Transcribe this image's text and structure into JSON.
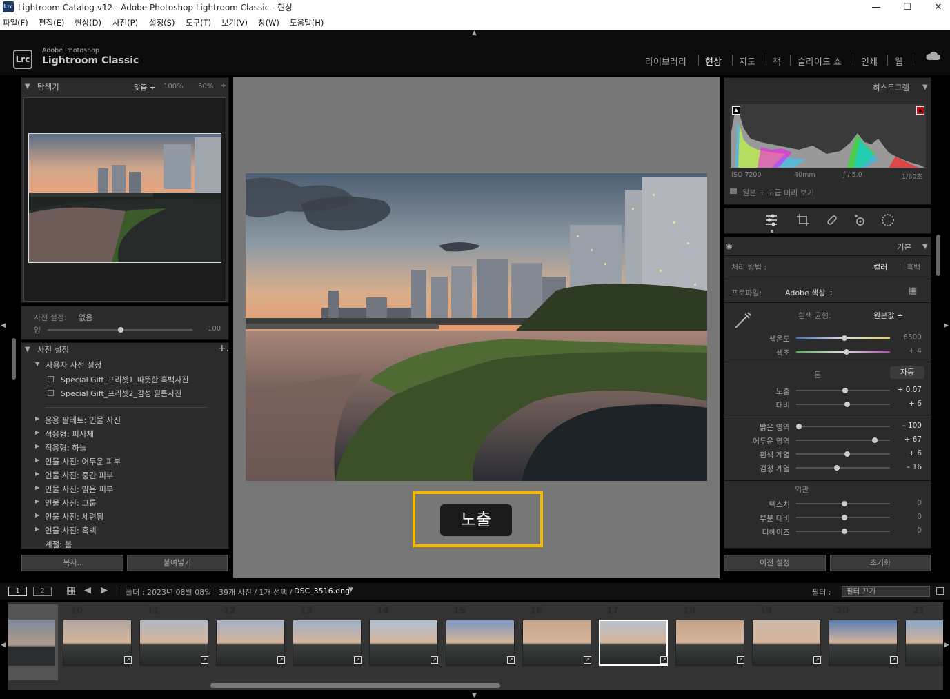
{
  "window": {
    "title": "Lightroom Catalog-v12 - Adobe Photoshop Lightroom Classic - 현상",
    "app_icon": "Lrc"
  },
  "menu": [
    "파일(F)",
    "편집(E)",
    "현상(D)",
    "사진(P)",
    "설정(S)",
    "도구(T)",
    "보기(V)",
    "창(W)",
    "도움말(H)"
  ],
  "brand": {
    "logo": "Lrc",
    "line1": "Adobe Photoshop",
    "line2": "Lightroom Classic"
  },
  "modules": [
    "라이브러리",
    "현상",
    "지도",
    "책",
    "슬라이드 쇼",
    "인쇄",
    "웹"
  ],
  "active_module": "현상",
  "navigator": {
    "title": "탐색기",
    "zoom_fit": "맞춤 ÷",
    "zoom_100": "100%",
    "zoom_50": "50%",
    "zoom_more": "÷"
  },
  "preset_amount": {
    "label": "사전 설정:",
    "value": "없음",
    "amount_label": "양",
    "amount_value": "100"
  },
  "presets": {
    "title": "사전 설정",
    "add": "+.",
    "user_group": "사용자 사전 설정",
    "user_items": [
      "Special Gift_프리셋1_따뜻한 흑백사진",
      "Special Gift_프리셋2_감성 필름사진"
    ],
    "groups": [
      "응용 팔레트: 인물 사진",
      "적응형: 피사체",
      "적응형: 하늘",
      "인물 사진: 어두운 피부",
      "인물 사진: 중간 피부",
      "인물 사진: 밝은 피부",
      "인물 사진: 그룹",
      "인물 사진: 세련됨",
      "인물 사진: 흑백",
      "계절: 봄"
    ]
  },
  "left_buttons": {
    "copy": "복사..",
    "paste": "붙여넣기"
  },
  "center": {
    "overlay_label": "노출"
  },
  "histogram": {
    "title": "히스토그램",
    "iso": "ISO 7200",
    "focal": "40mm",
    "aperture": "ƒ / 5.0",
    "shutter": "1/60초",
    "preview": "원본 + 고급 미리 보기"
  },
  "basic": {
    "title": "기본",
    "treatment_label": "처리 방법 :",
    "treatment_color": "컬러",
    "treatment_bw": "흑백",
    "profile_label": "프로파일:",
    "profile_value": "Adobe 색상 ÷",
    "wb_label": "흰색 균형:",
    "wb_value": "원본값 ÷",
    "tone_label": "톤",
    "auto": "자동",
    "presence_label": "외관",
    "sliders": [
      {
        "label": "색온도",
        "value": "6500",
        "pos": 0.5
      },
      {
        "label": "색조",
        "value": "+ 4",
        "pos": 0.52
      },
      {
        "label": "노출",
        "value": "+ 0.07",
        "pos": 0.51
      },
      {
        "label": "대비",
        "value": "+ 6",
        "pos": 0.53
      },
      {
        "label": "밝은 영역",
        "value": "– 100",
        "pos": 0.0
      },
      {
        "label": "어두운 영역",
        "value": "+ 67",
        "pos": 0.83
      },
      {
        "label": "흰색 계열",
        "value": "+ 6",
        "pos": 0.53
      },
      {
        "label": "검정 계열",
        "value": "– 16",
        "pos": 0.42
      },
      {
        "label": "텍스처",
        "value": "0",
        "pos": 0.5
      },
      {
        "label": "부분 대비",
        "value": "0",
        "pos": 0.5
      },
      {
        "label": "디헤이즈",
        "value": "0",
        "pos": 0.5
      }
    ]
  },
  "right_buttons": {
    "previous": "이전 설정",
    "reset": "초기화"
  },
  "filmstrip_bar": {
    "view1": "1",
    "view2": "2",
    "folder": "폴더 : 2023년 08월 08일",
    "count": "39개 사진 / 1개 선택 /",
    "filename": "DSC_3516.dng",
    "filter_label": "필터 :",
    "filter_value": "필터 끄기"
  },
  "filmstrip": [
    "10",
    "11",
    "12",
    "13",
    "14",
    "15",
    "16",
    "17",
    "18",
    "19",
    "20",
    "21"
  ],
  "selected_frame": "17",
  "colors": {
    "panel": "#2b2b2b",
    "bg": "#0b0b0b",
    "highlight": "#f5b800"
  }
}
